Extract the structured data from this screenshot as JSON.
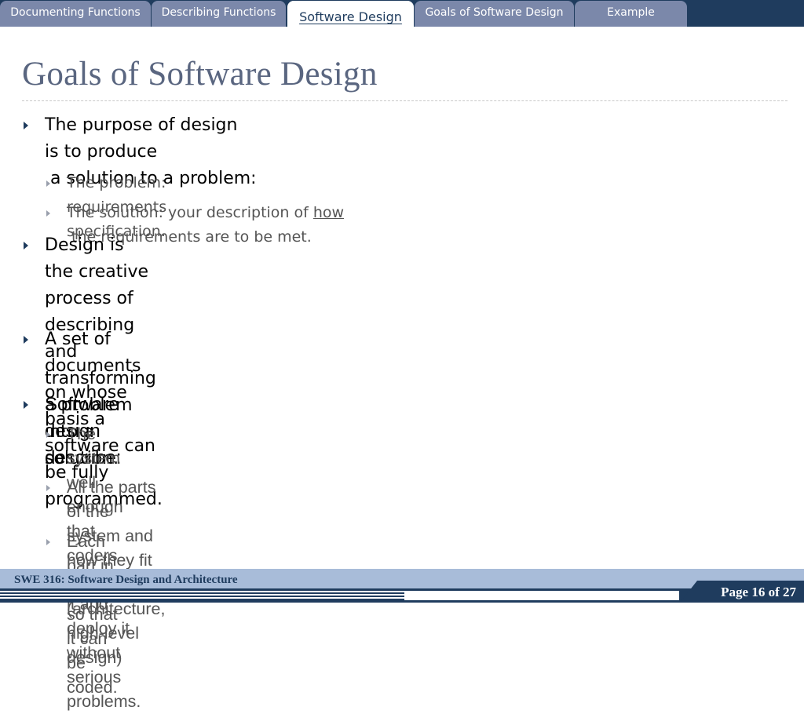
{
  "tabs": [
    {
      "label": "Documenting Functions",
      "active": false
    },
    {
      "label": "Describing Functions",
      "active": false
    },
    {
      "label": "Software Design",
      "active": true
    },
    {
      "label": "Goals of Software Design",
      "active": false
    },
    {
      "label": "Example",
      "active": false
    }
  ],
  "slide": {
    "title": "Goals of Software Design",
    "bullets": {
      "b1_line1": "The purpose of design is to produce",
      "b1_line2": " a solution to a problem:",
      "b1_sub1": "The problem: requirements specification.",
      "b1_sub2_pre": "The solution: your description of ",
      "b1_sub2_link": "how",
      "b1_sub2_post": " the requirements are to be met.",
      "b2_line1": "Design is the creative process of describing and transforming a problem into a",
      "b2_line2": "solution.",
      "b3": "A set of documents on whose basis a software can be fully programmed.",
      "b4": "Software design describe:",
      "b4_sub1_line1": "The system well enough that coders can build it and deploy it without serious",
      "b4_sub1_line2": "problems.",
      "b4_sub2_line1": "All the parts of the system and how they fit together (architecture, high-level",
      "b4_sub2_line2": "design)",
      "b4_sub3": "Each part in detail so that it can be coded."
    }
  },
  "footer": {
    "course": "SWE 316: Software Design and Architecture",
    "page": "Page 16 of 27"
  },
  "colors": {
    "navy": "#1f3c5e",
    "tab_inactive": "#7b88aa",
    "title": "#5a6680",
    "footer_band": "#a8bcd9"
  }
}
